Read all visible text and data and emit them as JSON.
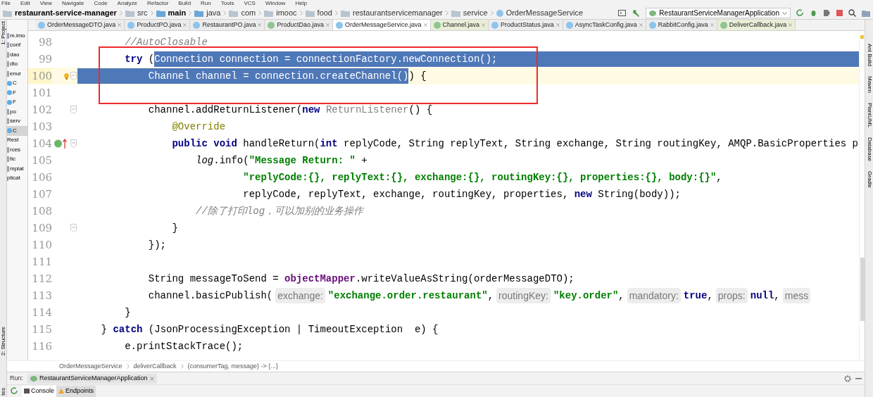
{
  "menu": [
    "File",
    "Edit",
    "View",
    "Navigate",
    "Code",
    "Analyze",
    "Refactor",
    "Build",
    "Run",
    "Tools",
    "VCS",
    "Window",
    "Help"
  ],
  "nav": {
    "crumbs": [
      {
        "label": "restaurant-service-manager",
        "kind": "project"
      },
      {
        "label": "src",
        "kind": "folder"
      },
      {
        "label": "main",
        "kind": "module"
      },
      {
        "label": "java",
        "kind": "source"
      },
      {
        "label": "com",
        "kind": "folder"
      },
      {
        "label": "imooc",
        "kind": "folder"
      },
      {
        "label": "food",
        "kind": "folder"
      },
      {
        "label": "restaurantservicemanager",
        "kind": "folder"
      },
      {
        "label": "service",
        "kind": "folder"
      },
      {
        "label": "OrderMessageService",
        "kind": "class"
      }
    ],
    "run_config": "RestaurantServiceManagerApplication"
  },
  "tabs": [
    {
      "label": "OrderMessageDTO.java",
      "kind": "class",
      "library": false,
      "selected": false
    },
    {
      "label": "ProductPO.java",
      "kind": "class",
      "library": false,
      "selected": false
    },
    {
      "label": "RestaurantPO.java",
      "kind": "class",
      "library": false,
      "selected": false
    },
    {
      "label": "ProductDao.java",
      "kind": "interface",
      "library": false,
      "selected": false
    },
    {
      "label": "OrderMessageService.java",
      "kind": "class",
      "library": false,
      "selected": true
    },
    {
      "label": "Channel.java",
      "kind": "interface",
      "library": true,
      "selected": false
    },
    {
      "label": "ProductStatus.java",
      "kind": "enum",
      "library": false,
      "selected": false
    },
    {
      "label": "AsyncTaskConfig.java",
      "kind": "class",
      "library": false,
      "selected": false
    },
    {
      "label": "RabbitConfig.java",
      "kind": "class",
      "library": false,
      "selected": false
    },
    {
      "label": "DeliverCallback.java",
      "kind": "interface",
      "library": true,
      "selected": false
    }
  ],
  "left_strip": [
    "1: Project",
    "2: Structure",
    "tes"
  ],
  "project_tree": [
    {
      "label": "m.imo",
      "kind": "folder",
      "selected": false
    },
    {
      "label": "conf",
      "kind": "folder",
      "selected": false
    },
    {
      "label": "dao",
      "kind": "folder",
      "selected": false
    },
    {
      "label": "dto",
      "kind": "folder",
      "selected": false
    },
    {
      "label": "enur",
      "kind": "folder",
      "selected": false
    },
    {
      "label": "C",
      "kind": "enum",
      "selected": false
    },
    {
      "label": "F",
      "kind": "enum",
      "selected": false
    },
    {
      "label": "F",
      "kind": "enum",
      "selected": false
    },
    {
      "label": "po",
      "kind": "folder",
      "selected": false
    },
    {
      "label": "serv",
      "kind": "folder",
      "selected": false
    },
    {
      "label": "C",
      "kind": "class",
      "selected": true
    },
    {
      "label": "Rest",
      "kind": "file",
      "selected": false
    },
    {
      "label": "rces",
      "kind": "folder",
      "selected": false
    },
    {
      "label": "tic",
      "kind": "folder",
      "selected": false
    },
    {
      "label": "mplat",
      "kind": "folder",
      "selected": false
    },
    {
      "label": "plicat",
      "kind": "file",
      "selected": false
    }
  ],
  "editor": {
    "blocks": [
      {
        "kind": "plain",
        "lines": [
          {
            "number": "98",
            "current": false,
            "tokens": [
              {
                "kind": "comment",
                "t": "        //AutoClosable",
                "selected": false
              }
            ]
          }
        ]
      },
      {
        "kind": "annotated",
        "lines": [
          {
            "number": "99",
            "current": false,
            "tokens": [
              {
                "kind": "keyword",
                "t": "        try",
                "selected": false
              },
              {
                "kind": "plain",
                "t": " (",
                "selected": false
              },
              {
                "kind": "plain",
                "t": "Connection connection = connectionFactory.newConnection();",
                "selected": true
              }
            ]
          },
          {
            "number": "100",
            "current": true,
            "gutter_icons": [
              {
                "kind": "bulb"
              },
              {
                "kind": "fold"
              }
            ],
            "tokens": [
              {
                "kind": "plain",
                "t": "            Channel channel = connection.createChannel()",
                "selected": true
              },
              {
                "kind": "plain",
                "t": ") {",
                "selected": false
              }
            ]
          },
          {
            "number": "101",
            "current": false
          }
        ]
      },
      {
        "kind": "plain",
        "lines": [
          {
            "number": "102",
            "current": false,
            "gutter_icons": [
              {
                "kind": "fold"
              }
            ],
            "tokens": [
              {
                "kind": "plain",
                "t": "            channel.addReturnListener(",
                "selected": false
              },
              {
                "kind": "keyword",
                "t": "new",
                "selected": false
              },
              {
                "kind": "dim",
                "t": " ReturnListener",
                "selected": false
              },
              {
                "kind": "plain",
                "t": "() {",
                "selected": false
              }
            ]
          },
          {
            "number": "103",
            "current": false,
            "tokens": [
              {
                "kind": "annotation",
                "t": "                @Override",
                "selected": false
              }
            ]
          },
          {
            "number": "104",
            "current": false,
            "gutter_icons": [
              {
                "kind": "implements"
              },
              {
                "kind": "fold"
              }
            ],
            "tokens": [
              {
                "kind": "keyword",
                "t": "                public void",
                "selected": false
              },
              {
                "kind": "plain",
                "t": " handleReturn(",
                "selected": false
              },
              {
                "kind": "keyword",
                "t": "int",
                "selected": false
              },
              {
                "kind": "plain",
                "t": " replyCode, String replyText, String exchange, String routingKey, AMQP.BasicProperties p",
                "selected": false
              }
            ]
          },
          {
            "number": "105",
            "current": false,
            "tokens": [
              {
                "kind": "static",
                "t": "                    log",
                "selected": false
              },
              {
                "kind": "plain",
                "t": ".info(",
                "selected": false
              },
              {
                "kind": "string",
                "t": "\"Message Return: \"",
                "selected": false
              },
              {
                "kind": "plain",
                "t": " +",
                "selected": false
              }
            ]
          },
          {
            "number": "106",
            "current": false,
            "tokens": [
              {
                "kind": "string",
                "t": "                            \"replyCode:{}, replyText:{}, exchange:{}, routingKey:{}, properties:{}, body:{}\"",
                "selected": false
              },
              {
                "kind": "plain",
                "t": ",",
                "selected": false
              }
            ]
          },
          {
            "number": "107",
            "current": false,
            "tokens": [
              {
                "kind": "plain",
                "t": "                            replyCode, replyText, exchange, routingKey, properties, ",
                "selected": false
              },
              {
                "kind": "keyword",
                "t": "new",
                "selected": false
              },
              {
                "kind": "plain",
                "t": " String(body));",
                "selected": false
              }
            ]
          },
          {
            "number": "108",
            "current": false,
            "tokens": [
              {
                "kind": "comment",
                "t": "                    //除了打印log，可以加别的业务操作",
                "selected": false
              }
            ]
          },
          {
            "number": "109",
            "current": false,
            "gutter_icons": [
              {
                "kind": "fold"
              }
            ],
            "tokens": [
              {
                "kind": "plain",
                "t": "                }",
                "selected": false
              }
            ]
          },
          {
            "number": "110",
            "current": false,
            "tokens": [
              {
                "kind": "plain",
                "t": "            });",
                "selected": false
              }
            ]
          },
          {
            "number": "111",
            "current": false
          },
          {
            "number": "112",
            "current": false,
            "tokens": [
              {
                "kind": "plain",
                "t": "            String messageToSend = ",
                "selected": false
              },
              {
                "kind": "member",
                "t": "objectMapper",
                "selected": false
              },
              {
                "kind": "plain",
                "t": ".writeValueAsString(orderMessageDTO);",
                "selected": false
              }
            ]
          },
          {
            "number": "113",
            "current": false,
            "tokens": [
              {
                "kind": "plain",
                "t": "            channel.basicPublish(",
                "selected": false
              },
              {
                "kind": "hint",
                "t": "exchange:",
                "selected": false
              },
              {
                "kind": "string",
                "t": "\"exchange.order.restaurant\"",
                "selected": false
              },
              {
                "kind": "plain",
                "t": ",",
                "selected": false
              },
              {
                "kind": "hint",
                "t": "routingKey:",
                "selected": false
              },
              {
                "kind": "string",
                "t": "\"key.order\"",
                "selected": false
              },
              {
                "kind": "plain",
                "t": ",",
                "selected": false
              },
              {
                "kind": "hint",
                "t": "mandatory:",
                "selected": false
              },
              {
                "kind": "keyword",
                "t": "true",
                "selected": false
              },
              {
                "kind": "plain",
                "t": ",",
                "selected": false
              },
              {
                "kind": "hint",
                "t": "props:",
                "selected": false
              },
              {
                "kind": "keyword",
                "t": "null",
                "selected": false
              },
              {
                "kind": "plain",
                "t": ",",
                "selected": false
              },
              {
                "kind": "hint",
                "t": "mess",
                "selected": false
              }
            ]
          },
          {
            "number": "114",
            "current": false,
            "tokens": [
              {
                "kind": "plain",
                "t": "        }",
                "selected": false
              }
            ]
          },
          {
            "number": "115",
            "current": false,
            "tokens": [
              {
                "kind": "plain",
                "t": "    } ",
                "selected": false
              },
              {
                "kind": "keyword",
                "t": "catch",
                "selected": false
              },
              {
                "kind": "plain",
                "t": " (JsonProcessingException | TimeoutException  e) {",
                "selected": false
              }
            ]
          },
          {
            "number": "116",
            "current": false,
            "tokens": [
              {
                "kind": "plain",
                "t": "        e.printStackTrace();",
                "selected": false
              }
            ]
          }
        ]
      }
    ]
  },
  "right_strip": [
    "Ant Build",
    "Maven",
    "PlantUML",
    "Database",
    "Gradle"
  ],
  "editor_breadcrumbs": [
    "OrderMessageService",
    "deliverCallback",
    "(consumerTag, message) -> {...}"
  ],
  "run": {
    "label": "Run:",
    "tab": "RestaurantServiceManagerApplication"
  },
  "console_tabs": [
    {
      "label": "Console",
      "kind": "console",
      "selected": false
    },
    {
      "label": "Endpoints",
      "kind": "endpoints",
      "selected": true
    }
  ]
}
